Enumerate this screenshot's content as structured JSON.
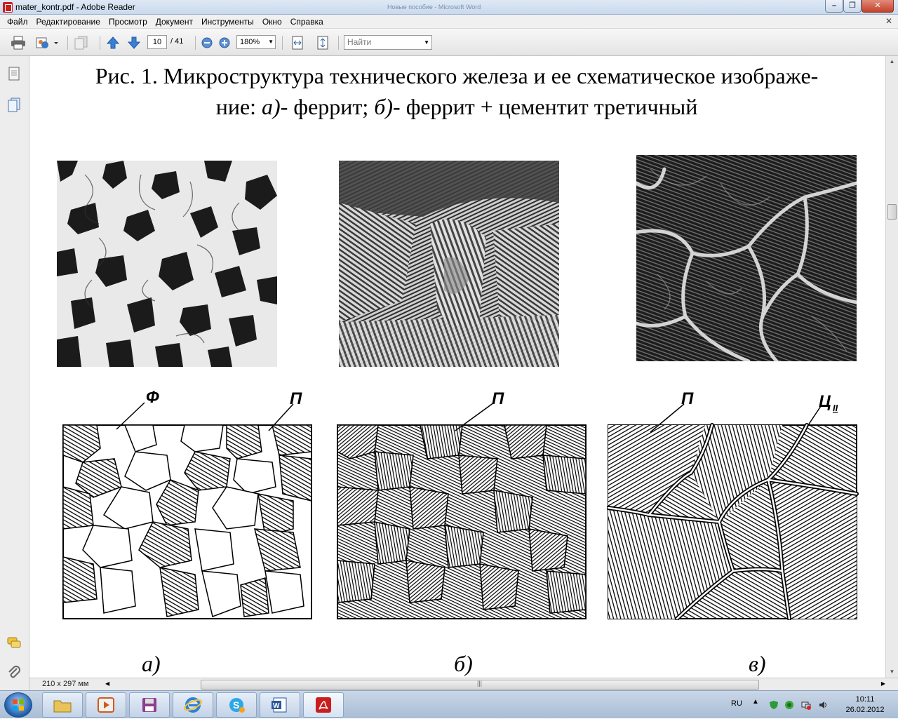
{
  "window": {
    "title": "mater_kontr.pdf - Adobe Reader",
    "background_title": "Новые пособие - Microsoft Word"
  },
  "menu": [
    "Файл",
    "Редактирование",
    "Просмотр",
    "Документ",
    "Инструменты",
    "Окно",
    "Справка"
  ],
  "toolbar": {
    "page_current": "10",
    "page_total": "/ 41",
    "zoom": "180%",
    "search_placeholder": "Найти"
  },
  "document": {
    "caption_line1": "Рис. 1. Микроструктура технического железа и ее схематическое изображе-",
    "caption_line2_prefix": "ние: ",
    "caption_a": "а)",
    "caption_mid": "- феррит; ",
    "caption_b": "б)",
    "caption_end": "- феррит + цементит третичный",
    "labels": {
      "ferrite": "Ф",
      "pearlite_a": "П",
      "pearlite_b": "П",
      "pearlite_c": "П",
      "cementite": "Ц",
      "cementite_sub": "II"
    },
    "panels": [
      "а)",
      "б)",
      "в)"
    ]
  },
  "status": {
    "page_size": "210 x 297 мм"
  },
  "taskbar": {
    "language": "RU",
    "time": "10:11",
    "date": "26.02.2012"
  }
}
